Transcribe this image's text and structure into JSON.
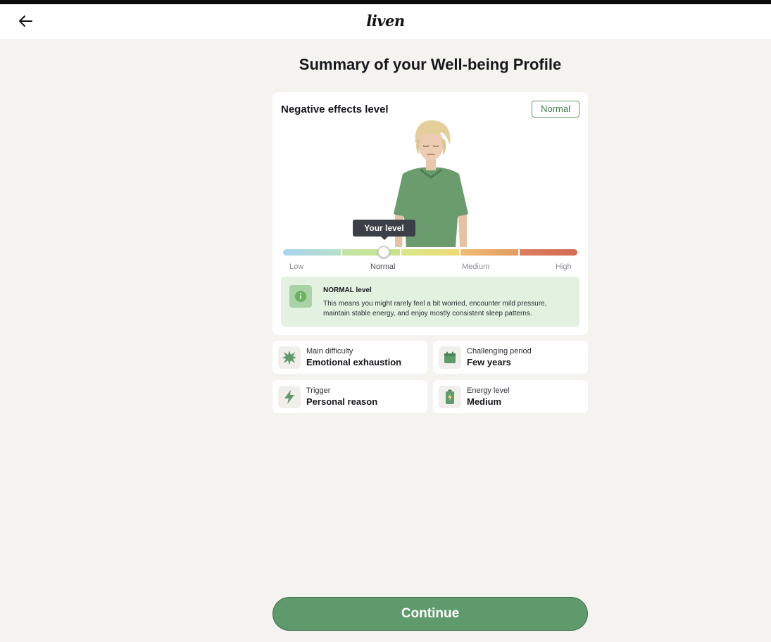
{
  "header": {
    "brand": "liven",
    "back_icon": "arrow-left-icon"
  },
  "page": {
    "title": "Summary of your Well-being Profile"
  },
  "summary_card": {
    "title": "Negative effects level",
    "badge": "Normal",
    "tooltip": "Your level",
    "scale": {
      "labels": [
        "Low",
        "Normal",
        "Medium",
        "High"
      ],
      "current_label": "Normal",
      "current_fraction": 0.34
    },
    "info": {
      "icon": "info-icon",
      "title": "NORMAL level",
      "text": "This means you might rarely feel a bit worried, encounter mild pressure, maintain stable energy, and enjoy mostly consistent sleep patterns."
    }
  },
  "stats": [
    {
      "icon": "burst-icon",
      "label": "Main difficulty",
      "value": "Emotional exhaustion"
    },
    {
      "icon": "calendar-icon",
      "label": "Challenging period",
      "value": "Few years"
    },
    {
      "icon": "lightning-icon",
      "label": "Trigger",
      "value": "Personal reason"
    },
    {
      "icon": "battery-icon",
      "label": "Energy level",
      "value": "Medium"
    }
  ],
  "footer": {
    "continue_label": "Continue"
  },
  "colors": {
    "page_bg": "#f4f3ef",
    "accent_green": "#5e9a6c",
    "badge_green": "#3f7a45",
    "info_bg": "#e3f1e1",
    "tooltip_bg": "#3b3f48"
  }
}
